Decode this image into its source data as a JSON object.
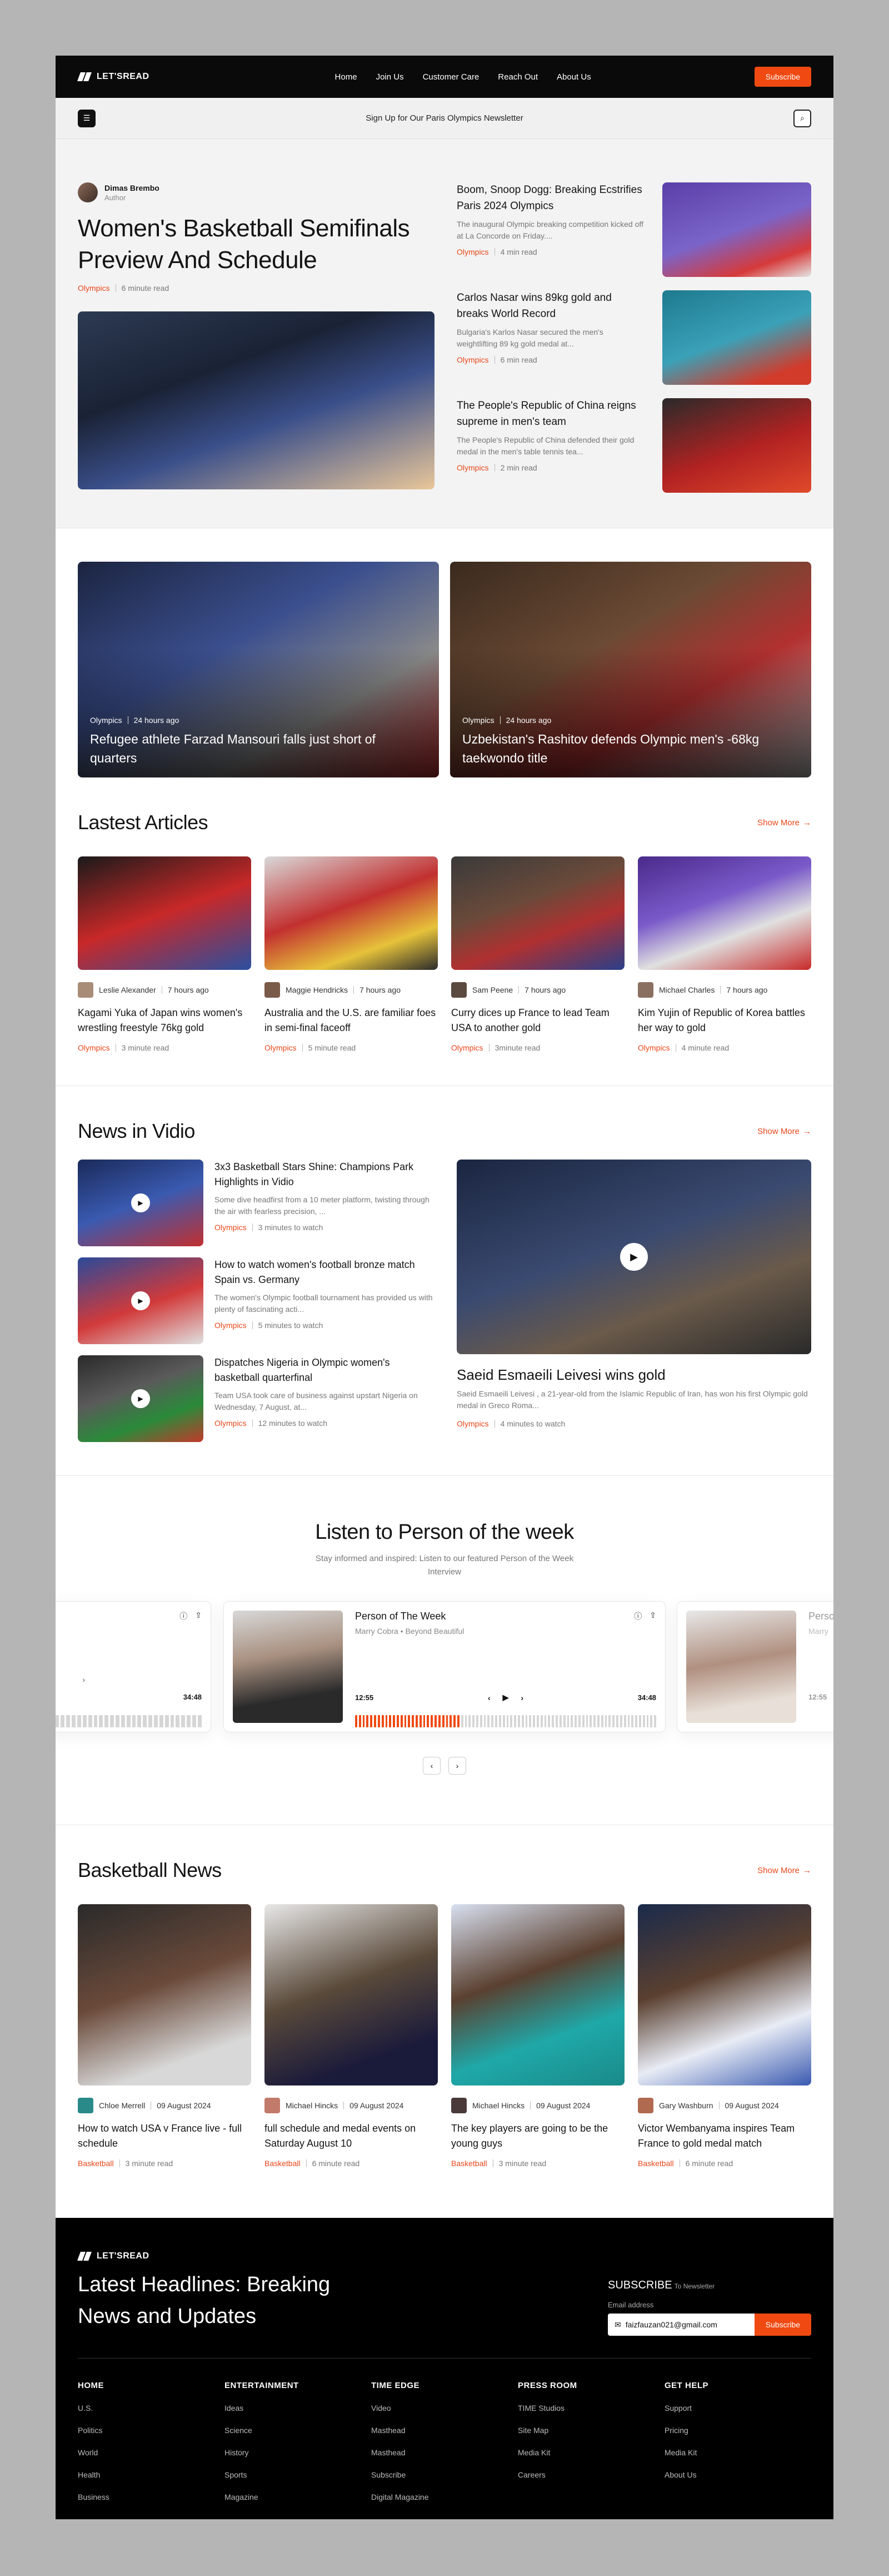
{
  "brand": {
    "name": "LET'SREAD"
  },
  "nav": {
    "links": [
      "Home",
      "Join Us",
      "Customer Care",
      "Reach Out",
      "About Us"
    ],
    "cta": "Subscribe"
  },
  "subbar": {
    "text": "Sign Up for Our Paris Olympics Newsletter"
  },
  "hero": {
    "author_name": "Dimas Brembo",
    "author_role": "Author",
    "title": "Women's Basketball Semifinals Preview And Schedule",
    "category": "Olympics",
    "read_time": "6 minute read",
    "side": [
      {
        "title": "Boom, Snoop Dogg: Breaking Ecstrifies Paris 2024 Olympics",
        "excerpt": "The inaugural Olympic breaking competition kicked off at La Concorde on Friday....",
        "category": "Olympics",
        "read_time": "4 min read"
      },
      {
        "title": "Carlos Nasar wins 89kg gold and breaks World Record",
        "excerpt": "Bulgaria's Karlos Nasar secured the men's weightlifting 89 kg gold medal at...",
        "category": "Olympics",
        "read_time": "6 min read"
      },
      {
        "title": "The People's Republic of China reigns supreme in men's team",
        "excerpt": "The People's Republic of China defended their gold medal in the men's table tennis tea...",
        "category": "Olympics",
        "read_time": "2 min read"
      }
    ]
  },
  "features": [
    {
      "category": "Olympics",
      "time": "24 hours ago",
      "title": "Refugee athlete Farzad Mansouri falls just short of quarters"
    },
    {
      "category": "Olympics",
      "time": "24 hours ago",
      "title": "Uzbekistan's Rashitov defends Olympic men's -68kg taekwondo title"
    }
  ],
  "latest": {
    "title": "Lastest Articles",
    "show_more": "Show More",
    "items": [
      {
        "author": "Leslie Alexander",
        "time": "7 hours ago",
        "title": "Kagami Yuka of Japan wins women's wrestling freestyle 76kg gold",
        "category": "Olympics",
        "read_time": "3 minute read"
      },
      {
        "author": "Maggie Hendricks",
        "time": "7 hours ago",
        "title": "Australia and the U.S. are familiar foes in semi-final faceoff",
        "category": "Olympics",
        "read_time": "5 minute read"
      },
      {
        "author": "Sam Peene",
        "time": "7 hours ago",
        "title": "Curry dices up France to lead Team USA to another gold",
        "category": "Olympics",
        "read_time": "3minute read"
      },
      {
        "author": "Michael Charles",
        "time": "7 hours ago",
        "title": "Kim Yujin of Republic of Korea battles her way to gold",
        "category": "Olympics",
        "read_time": "4 minute read"
      }
    ]
  },
  "vidio": {
    "title": "News in Vidio",
    "show_more": "Show More",
    "items": [
      {
        "title": "3x3 Basketball Stars Shine: Champions Park Highlights in Vidio",
        "excerpt": "Some dive headfirst from a 10 meter platform, twisting through the air with fearless precision, ...",
        "category": "Olympics",
        "watch": "3 minutes to watch"
      },
      {
        "title": "How to watch women's football bronze match Spain vs. Germany",
        "excerpt": "The women's Olympic football tournament has provided us with plenty of fascinating acti...",
        "category": "Olympics",
        "watch": "5 minutes to watch"
      },
      {
        "title": "Dispatches Nigeria in Olympic women's basketball quarterfinal",
        "excerpt": "Team USA took care of business against upstart Nigeria on Wednesday, 7 August, at...",
        "category": "Olympics",
        "watch": "12 minutes to watch"
      }
    ],
    "big": {
      "title": "Saeid Esmaeili Leivesi wins gold",
      "excerpt": "Saeid Esmaeili Leivesi , a 21-year-old from the Islamic Republic of Iran, has won his first Olympic gold medal in Greco Roma...",
      "category": "Olympics",
      "watch": "4 minutes to watch"
    }
  },
  "podcast": {
    "title": "Listen to Person of the week",
    "subtitle": "Stay informed and inspired: Listen to our featured Person of the Week Interview",
    "active": {
      "name": "Person of The Week",
      "role": "Marry Cobra • Beyond Beautiful",
      "current": "12:55",
      "total": "34:48",
      "progress": 0.34
    },
    "left_total": "34:48",
    "right": {
      "name": "Perso",
      "role": "Marry",
      "current": "12:55"
    }
  },
  "basketball": {
    "title": "Basketball News",
    "show_more": "Show More",
    "items": [
      {
        "author": "Chloe Merrell",
        "date": "09 August 2024",
        "title": "How to watch USA v France live - full schedule",
        "category": "Basketball",
        "read_time": "3 minute read"
      },
      {
        "author": "Michael Hincks",
        "date": "09 August 2024",
        "title": "full schedule and medal events on Saturday August 10",
        "category": "Basketball",
        "read_time": "6 minute read"
      },
      {
        "author": "Michael Hincks",
        "date": "09 August 2024",
        "title": "The key players are going to be the young guys",
        "category": "Basketball",
        "read_time": "3 minute read"
      },
      {
        "author": "Gary Washburn",
        "date": "09 August 2024",
        "title": "Victor Wembanyama inspires Team France to gold medal match",
        "category": "Basketball",
        "read_time": "6 minute read"
      }
    ]
  },
  "footer": {
    "brand": "LET'SREAD",
    "title": "Latest Headlines: Breaking News and Updates",
    "subscribe_title": "SUBSCRIBE",
    "subscribe_sub": "To Newsletter",
    "email_label": "Email address",
    "email_value": "faizfauzan021@gmail.com",
    "subscribe_btn": "Subscribe",
    "cols": [
      {
        "head": "HOME",
        "items": [
          "U.S.",
          "Politics",
          "World",
          "Health",
          "Business"
        ]
      },
      {
        "head": "ENTERTAINMENT",
        "items": [
          "Ideas",
          "Science",
          "History",
          "Sports",
          "Magazine"
        ]
      },
      {
        "head": "TIME EDGE",
        "items": [
          "Video",
          "Masthead",
          "Masthead",
          "Subscribe",
          "Digital Magazine"
        ]
      },
      {
        "head": "PRESS ROOM",
        "items": [
          "TIME Studios",
          "Site Map",
          "Media Kit",
          "Careers"
        ]
      },
      {
        "head": "GET HELP",
        "items": [
          "Support",
          "Pricing",
          "Media Kit",
          "About Us"
        ]
      }
    ]
  },
  "colors": {
    "accent": "#f04a12",
    "dark": "#0a0a0a"
  }
}
